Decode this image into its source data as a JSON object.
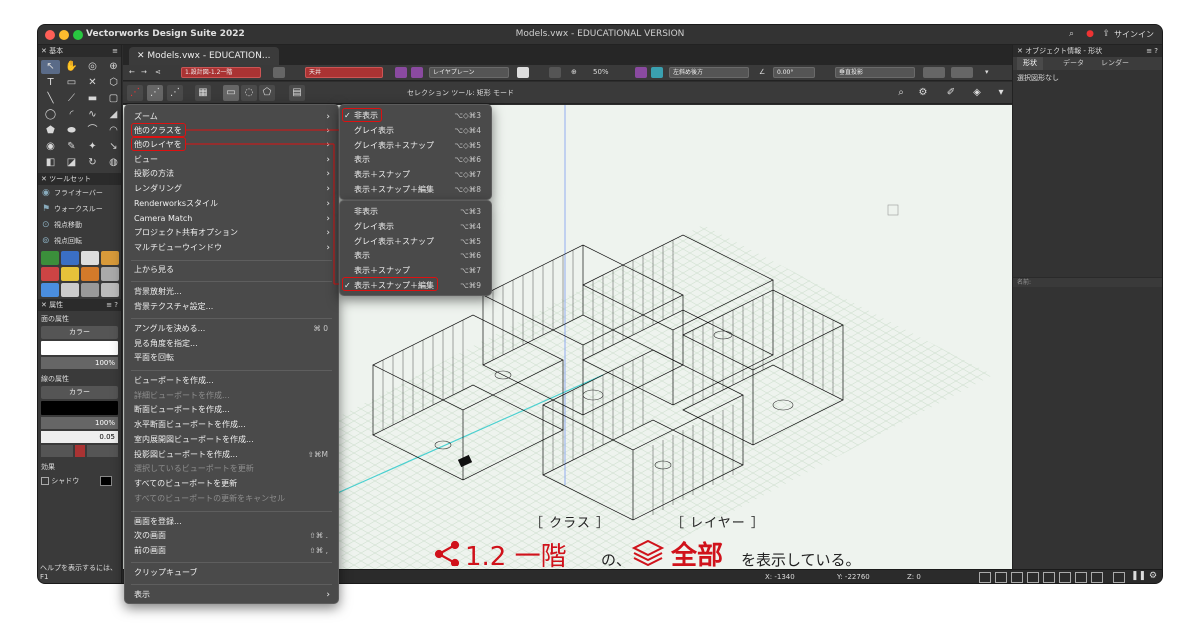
{
  "window": {
    "app_title": "Vectorworks Design Suite 2022",
    "doc_title": "Models.vwx - EDUCATIONAL VERSION",
    "signin": "サインイン",
    "doc_tab": "Models.vwx - EDUCATION..."
  },
  "left_panel": {
    "basic_header": "基本",
    "toolset_header": "ツールセット",
    "toolset_items": [
      "フライオーバー",
      "ウォークスルー",
      "視点移動",
      "視点回転"
    ],
    "attr_header": "属性",
    "fill_label": "面の属性",
    "fill_mode": "カラー",
    "fill_opacity": "100%",
    "line_label": "線の属性",
    "line_mode": "カラー",
    "line_opacity": "100%",
    "line_weight": "0.05",
    "effects_label": "効果",
    "shadow_label": "シャドウ",
    "help_text": "ヘルプを表示するには、F1"
  },
  "view_bar": {
    "class_value": "1.設計図-1.2一階",
    "story_value": "天井",
    "layer_plane": "レイヤプレーン",
    "zoom": "50%",
    "view_mode": "左斜め後方",
    "angle": "0.00°",
    "projection": "垂直投影"
  },
  "mode_bar": {
    "mode_label": "セレクション ツール: 矩形 モード"
  },
  "main_menu": {
    "items": [
      {
        "label": "ズーム",
        "submenu": true
      },
      {
        "label": "他のクラスを",
        "submenu": true
      },
      {
        "label": "他のレイヤを",
        "submenu": true
      },
      {
        "label": "ビュー",
        "submenu": true
      },
      {
        "label": "投影の方法",
        "submenu": true
      },
      {
        "label": "レンダリング",
        "submenu": true
      },
      {
        "label": "Renderworksスタイル",
        "submenu": true
      },
      {
        "label": "Camera Match",
        "submenu": true
      },
      {
        "label": "プロジェクト共有オプション",
        "submenu": true
      },
      {
        "label": "マルチビューウインドウ",
        "submenu": true
      },
      {
        "label": "上から見る"
      },
      {
        "label": "背景放射光..."
      },
      {
        "label": "背景テクスチャ設定..."
      },
      {
        "label": "アングルを決める...",
        "shortcut": "⌘ 0"
      },
      {
        "label": "見る角度を指定..."
      },
      {
        "label": "平面を回転"
      },
      {
        "label": "ビューポートを作成..."
      },
      {
        "label": "詳細ビューポートを作成...",
        "disabled": true
      },
      {
        "label": "断面ビューポートを作成..."
      },
      {
        "label": "水平断面ビューポートを作成..."
      },
      {
        "label": "室内展開図ビューポートを作成..."
      },
      {
        "label": "投影図ビューポートを作成...",
        "shortcut": "⇧⌘M"
      },
      {
        "label": "選択しているビューポートを更新",
        "disabled": true
      },
      {
        "label": "すべてのビューポートを更新"
      },
      {
        "label": "すべてのビューポートの更新をキャンセル",
        "disabled": true
      },
      {
        "label": "画面を登録..."
      },
      {
        "label": "次の画面",
        "shortcut": "⇧⌘ ."
      },
      {
        "label": "前の画面",
        "shortcut": "⇧⌘ ,"
      },
      {
        "label": "クリップキューブ"
      },
      {
        "label": "表示",
        "submenu": true
      }
    ]
  },
  "class_submenu": {
    "items": [
      {
        "label": "非表示",
        "shortcut": "⌥◇⌘3",
        "checked": true
      },
      {
        "label": "グレイ表示",
        "shortcut": "⌥◇⌘4"
      },
      {
        "label": "グレイ表示＋スナップ",
        "shortcut": "⌥◇⌘5"
      },
      {
        "label": "表示",
        "shortcut": "⌥◇⌘6"
      },
      {
        "label": "表示＋スナップ",
        "shortcut": "⌥◇⌘7"
      },
      {
        "label": "表示＋スナップ＋編集",
        "shortcut": "⌥◇⌘8"
      }
    ]
  },
  "layer_submenu": {
    "items": [
      {
        "label": "非表示",
        "shortcut": "⌥⌘3"
      },
      {
        "label": "グレイ表示",
        "shortcut": "⌥⌘4"
      },
      {
        "label": "グレイ表示＋スナップ",
        "shortcut": "⌥⌘5"
      },
      {
        "label": "表示",
        "shortcut": "⌥⌘6"
      },
      {
        "label": "表示＋スナップ",
        "shortcut": "⌥⌘7"
      },
      {
        "label": "表示＋スナップ＋編集",
        "shortcut": "⌥⌘9",
        "checked": true
      }
    ]
  },
  "right_panel": {
    "header": "オブジェクト情報 - 形状",
    "tabs": [
      "形状",
      "データ",
      "レンダー"
    ],
    "status": "選択図形なし",
    "name_label": "名前:"
  },
  "status_bar": {
    "x": "X: -1340",
    "y": "Y: -22760",
    "z": "Z: 0"
  },
  "annotation": {
    "class_tag": "［ クラス ］",
    "layer_tag": "［ レイヤー ］",
    "class_value": "1.2 一階",
    "particle": "の、",
    "layer_value": "全部",
    "tail": "を表示している。",
    "accent_color": "#d0121b"
  }
}
